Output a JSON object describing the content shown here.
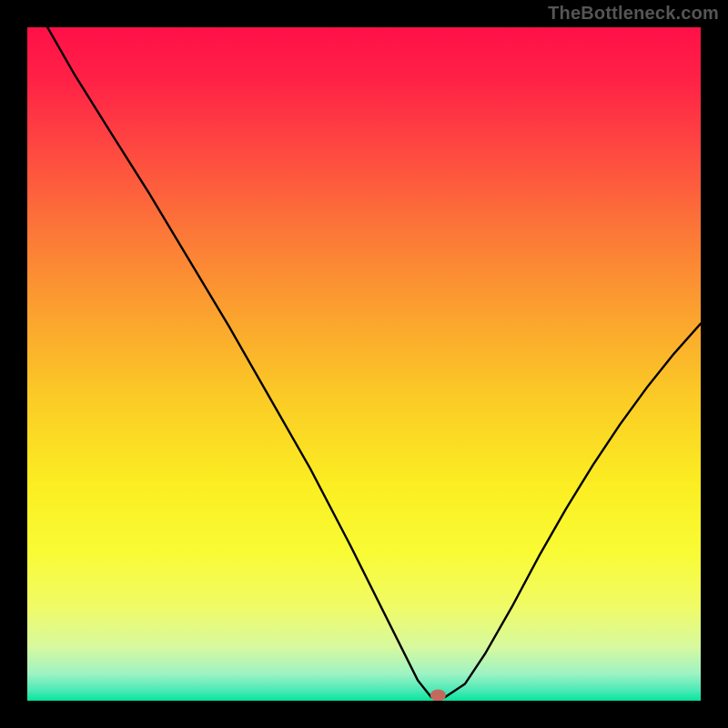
{
  "watermark": "TheBottleneck.com",
  "colors": {
    "page_bg": "#000000",
    "curve": "#000000",
    "marker": "#C46A5C"
  },
  "gradient_stops": [
    {
      "offset": 0.0,
      "color": "#FF1048"
    },
    {
      "offset": 0.08,
      "color": "#FF2246"
    },
    {
      "offset": 0.18,
      "color": "#FE4841"
    },
    {
      "offset": 0.3,
      "color": "#FC7638"
    },
    {
      "offset": 0.42,
      "color": "#FBA02F"
    },
    {
      "offset": 0.55,
      "color": "#FBCB26"
    },
    {
      "offset": 0.68,
      "color": "#FBEE22"
    },
    {
      "offset": 0.78,
      "color": "#F9FB35"
    },
    {
      "offset": 0.86,
      "color": "#F0FB66"
    },
    {
      "offset": 0.92,
      "color": "#D7F99E"
    },
    {
      "offset": 0.96,
      "color": "#9EF3C4"
    },
    {
      "offset": 0.985,
      "color": "#4AE9B6"
    },
    {
      "offset": 1.0,
      "color": "#05E69B"
    }
  ],
  "chart_data": {
    "type": "line",
    "title": "",
    "xlabel": "",
    "ylabel": "",
    "xlim": [
      0,
      100
    ],
    "ylim": [
      0,
      100
    ],
    "x": [
      0,
      3,
      7,
      12,
      18,
      24,
      30,
      36,
      42,
      48,
      53,
      56,
      58,
      60,
      62,
      65,
      68,
      72,
      76,
      80,
      84,
      88,
      92,
      96,
      100
    ],
    "values": [
      105,
      100,
      93,
      85,
      75.5,
      65.5,
      55.5,
      45,
      34.5,
      23,
      13,
      7,
      3,
      0.5,
      0.5,
      2.5,
      7,
      14,
      21.5,
      28.5,
      35,
      41,
      46.5,
      51.5,
      56
    ],
    "marker": {
      "x": 61,
      "y": 0.8
    },
    "notes": "x is relative horizontal position (0-100), values are bottleneck percentage (0 = ideal / green bottom, 100 = red top). Curve dips to ~0 near x=60-62 then rises again."
  }
}
